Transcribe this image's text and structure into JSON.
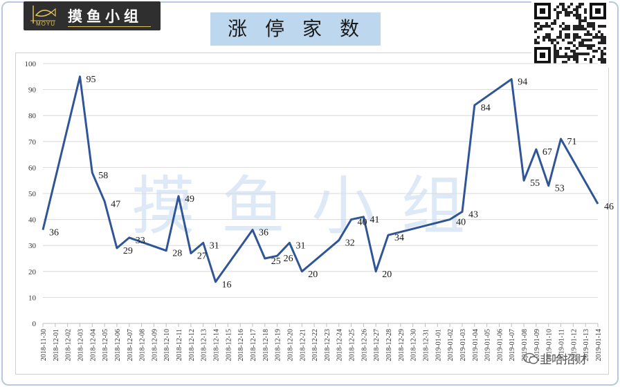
{
  "logo": {
    "text": "摸鱼小组",
    "subtext": "MOYU"
  },
  "title": "涨停家数",
  "watermark": "摸鱼小组",
  "footer_watermark": "韭哈招财",
  "icons": [
    "fish-logo-icon",
    "qr-code-icon",
    "wechat-icon"
  ],
  "colors": {
    "line": "#2f5597",
    "title_bg": "#bdd7ee",
    "watermark": "#dde9f6"
  },
  "chart_data": {
    "type": "line",
    "title": "涨停家数",
    "xlabel": "",
    "ylabel": "",
    "ylim": [
      0,
      100
    ],
    "yticks": [
      0,
      10,
      20,
      30,
      40,
      50,
      60,
      70,
      80,
      90,
      100
    ],
    "grid": true,
    "legend": "none",
    "categories": [
      "2018-11-30",
      "2018-12-01",
      "2018-12-02",
      "2018-12-03",
      "2018-12-04",
      "2018-12-05",
      "2018-12-06",
      "2018-12-07",
      "2018-12-08",
      "2018-12-09",
      "2018-12-10",
      "2018-12-11",
      "2018-12-12",
      "2018-12-13",
      "2018-12-14",
      "2018-12-15",
      "2018-12-16",
      "2018-12-17",
      "2018-12-18",
      "2018-12-19",
      "2018-12-20",
      "2018-12-21",
      "2018-12-22",
      "2018-12-23",
      "2018-12-24",
      "2018-12-25",
      "2018-12-26",
      "2018-12-27",
      "2018-12-28",
      "2018-12-29",
      "2018-12-30",
      "2018-12-31",
      "2019-01-01",
      "2019-01-02",
      "2019-01-03",
      "2019-01-04",
      "2019-01-05",
      "2019-01-06",
      "2019-01-07",
      "2019-01-08",
      "2019-01-09",
      "2019-01-10",
      "2019-01-11",
      "2019-01-12",
      "2019-01-13",
      "2019-01-14"
    ],
    "series": [
      {
        "values": [
          36,
          null,
          null,
          95,
          58,
          47,
          29,
          33,
          null,
          null,
          28,
          49,
          27,
          31,
          16,
          null,
          null,
          36,
          25,
          26,
          31,
          20,
          null,
          null,
          32,
          40,
          41,
          20,
          34,
          null,
          null,
          null,
          null,
          40,
          43,
          84,
          null,
          null,
          94,
          55,
          67,
          53,
          71,
          null,
          null,
          46
        ],
        "labels": [
          36,
          null,
          null,
          95,
          58,
          47,
          29,
          33,
          null,
          null,
          28,
          49,
          27,
          31,
          16,
          null,
          null,
          36,
          25,
          26,
          31,
          20,
          null,
          null,
          32,
          40,
          41,
          20,
          34,
          null,
          null,
          null,
          null,
          40,
          43,
          84,
          null,
          null,
          94,
          55,
          67,
          53,
          71,
          null,
          null,
          46
        ]
      }
    ]
  }
}
